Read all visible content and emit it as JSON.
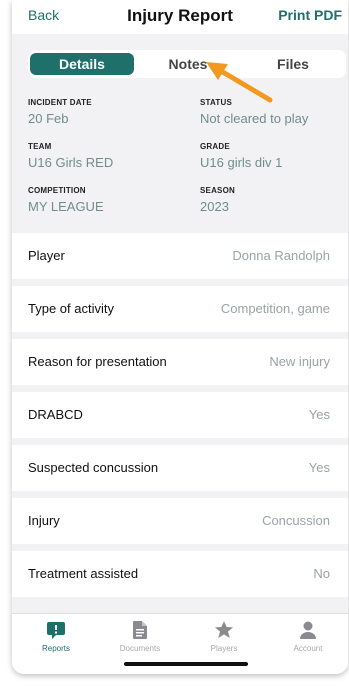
{
  "header": {
    "back_label": "Back",
    "title": "Injury Report",
    "print_label": "Print PDF"
  },
  "tabs": [
    {
      "label": "Details",
      "active": true
    },
    {
      "label": "Notes",
      "active": false
    },
    {
      "label": "Files",
      "active": false
    }
  ],
  "info": [
    {
      "label": "INCIDENT DATE",
      "value": "20 Feb"
    },
    {
      "label": "STATUS",
      "value": "Not cleared to play"
    },
    {
      "label": "TEAM",
      "value": "U16 Girls RED"
    },
    {
      "label": "GRADE",
      "value": "U16 girls div 1"
    },
    {
      "label": "COMPETITION",
      "value": "MY LEAGUE"
    },
    {
      "label": "SEASON",
      "value": "2023"
    }
  ],
  "rows": [
    {
      "label": "Player",
      "value": "Donna Randolph"
    },
    {
      "label": "Type of activity",
      "value": "Competition, game"
    },
    {
      "label": "Reason for presentation",
      "value": "New injury"
    },
    {
      "label": "DRABCD",
      "value": "Yes"
    },
    {
      "label": "Suspected concussion",
      "value": "Yes"
    },
    {
      "label": "Injury",
      "value": "Concussion"
    },
    {
      "label": "Treatment assisted",
      "value": "No"
    }
  ],
  "tabbar": [
    {
      "label": "Reports",
      "icon": "reports-icon",
      "active": true
    },
    {
      "label": "Documents",
      "icon": "documents-icon",
      "active": false
    },
    {
      "label": "Players",
      "icon": "star-icon",
      "active": false
    },
    {
      "label": "Account",
      "icon": "person-icon",
      "active": false
    }
  ],
  "colors": {
    "accent": "#1f6f6b",
    "arrow": "#f29a1f",
    "muted_value": "#6f8d8b"
  }
}
